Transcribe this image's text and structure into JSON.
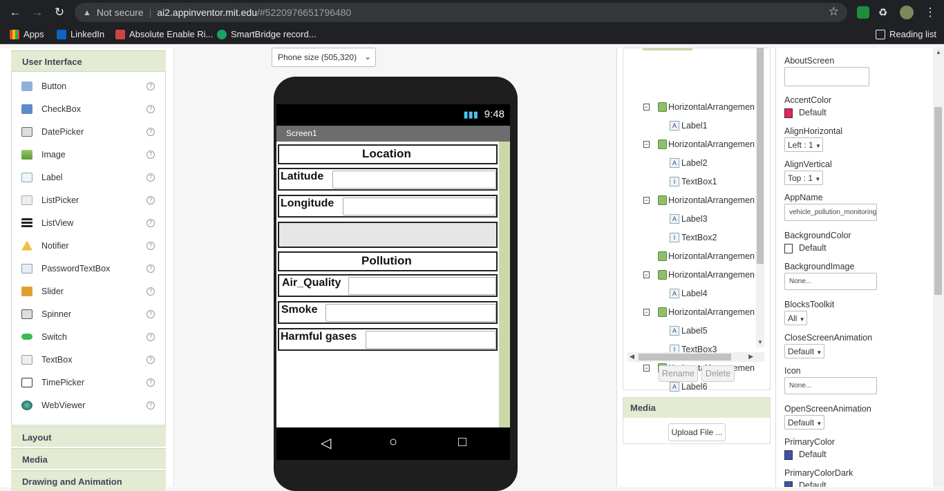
{
  "browser": {
    "security_label": "Not secure",
    "url_host": "ai2.appinventor.mit.edu",
    "url_path": "/#5220976651796480",
    "bookmarks": [
      "Apps",
      "LinkedIn",
      "Absolute Enable Ri...",
      "SmartBridge record..."
    ],
    "reading_list": "Reading list"
  },
  "palette": {
    "section_title": "User Interface",
    "items": [
      "Button",
      "CheckBox",
      "DatePicker",
      "Image",
      "Label",
      "ListPicker",
      "ListView",
      "Notifier",
      "PasswordTextBox",
      "Slider",
      "Spinner",
      "Switch",
      "TextBox",
      "TimePicker",
      "WebViewer"
    ],
    "help_glyph": "?",
    "other_sections": [
      "Layout",
      "Media",
      "Drawing and Animation"
    ]
  },
  "viewer": {
    "size_option": "Phone size (505,320)",
    "clock": "9:48",
    "screen_title": "Screen1",
    "rows": [
      "Location",
      "Latitude",
      "Longitude",
      "",
      "Pollution",
      "Air_Quality",
      "Smoke",
      "Harmful gases"
    ]
  },
  "components": {
    "tree": [
      {
        "name": "HorizontalArrangemen",
        "type": "arr",
        "collapsible": true
      },
      {
        "name": "Label1",
        "type": "label"
      },
      {
        "name": "HorizontalArrangemen",
        "type": "arr",
        "collapsible": true
      },
      {
        "name": "Label2",
        "type": "label"
      },
      {
        "name": "TextBox1",
        "type": "textbox"
      },
      {
        "name": "HorizontalArrangemen",
        "type": "arr",
        "collapsible": true
      },
      {
        "name": "Label3",
        "type": "label"
      },
      {
        "name": "TextBox2",
        "type": "textbox"
      },
      {
        "name": "HorizontalArrangemen",
        "type": "arr",
        "collapsible": false
      },
      {
        "name": "HorizontalArrangemen",
        "type": "arr",
        "collapsible": true
      },
      {
        "name": "Label4",
        "type": "label"
      },
      {
        "name": "HorizontalArrangemen",
        "type": "arr",
        "collapsible": true
      },
      {
        "name": "Label5",
        "type": "label"
      },
      {
        "name": "TextBox3",
        "type": "textbox"
      },
      {
        "name": "HorizontalArrangemen",
        "type": "arr",
        "collapsible": true
      },
      {
        "name": "Label6",
        "type": "label"
      }
    ],
    "rename_label": "Rename",
    "delete_label": "Delete"
  },
  "media": {
    "title": "Media",
    "upload_label": "Upload File ..."
  },
  "properties": {
    "about_screen": "AboutScreen",
    "accent_color_label": "AccentColor",
    "accent_color_value": "Default",
    "accent_color": "#e8245a",
    "align_h_label": "AlignHorizontal",
    "align_h_value": "Left : 1",
    "align_v_label": "AlignVertical",
    "align_v_value": "Top : 1",
    "app_name_label": "AppName",
    "app_name_value": "vehicle_pollution_monitoring",
    "bg_color_label": "BackgroundColor",
    "bg_color_value": "Default",
    "bg_image_label": "BackgroundImage",
    "bg_image_value": "None...",
    "blocks_toolkit_label": "BlocksToolkit",
    "blocks_toolkit_value": "All",
    "close_anim_label": "CloseScreenAnimation",
    "close_anim_value": "Default",
    "icon_label": "Icon",
    "icon_value": "None...",
    "open_anim_label": "OpenScreenAnimation",
    "open_anim_value": "Default",
    "primary_color_label": "PrimaryColor",
    "primary_color_value": "Default",
    "primary_color": "#3f51b5",
    "primary_dark_label": "PrimaryColorDark",
    "primary_dark_value": "Default"
  }
}
